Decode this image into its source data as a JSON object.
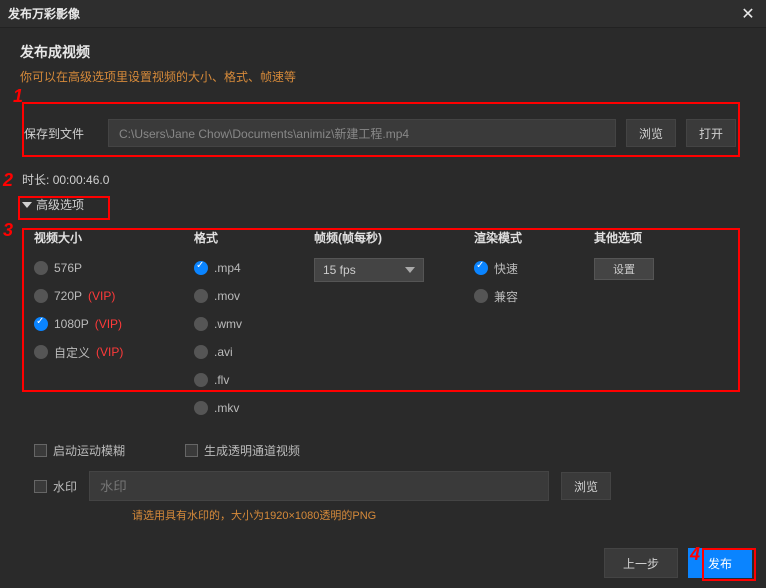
{
  "window": {
    "title": "发布万彩影像"
  },
  "section": {
    "heading": "发布成视频",
    "sub": "你可以在高级选项里设置视频的大小、格式、帧速等"
  },
  "file": {
    "label": "保存到文件",
    "path": "C:\\Users\\Jane Chow\\Documents\\animiz\\新建工程.mp4",
    "browse": "浏览",
    "open": "打开"
  },
  "duration": {
    "label": "时长:",
    "value": "00:00:46.0"
  },
  "advanced": {
    "label": "高级选项"
  },
  "columns": {
    "size": {
      "head": "视频大小",
      "opts": [
        {
          "label": "576P",
          "vip": false,
          "checked": false
        },
        {
          "label": "720P",
          "vip": true,
          "checked": false
        },
        {
          "label": "1080P",
          "vip": true,
          "checked": true
        },
        {
          "label": "自定义",
          "vip": true,
          "checked": false
        }
      ]
    },
    "format": {
      "head": "格式",
      "opts": [
        {
          "label": ".mp4",
          "checked": true
        },
        {
          "label": ".mov",
          "checked": false
        },
        {
          "label": ".wmv",
          "checked": false
        },
        {
          "label": ".avi",
          "checked": false
        },
        {
          "label": ".flv",
          "checked": false
        },
        {
          "label": ".mkv",
          "checked": false
        }
      ]
    },
    "fps": {
      "head": "帧频(帧每秒)",
      "value": "15 fps"
    },
    "render": {
      "head": "渲染模式",
      "opts": [
        {
          "label": "快速",
          "checked": true
        },
        {
          "label": "兼容",
          "checked": false
        }
      ]
    },
    "other": {
      "head": "其他选项",
      "btn": "设置"
    }
  },
  "extras": {
    "motion_blur": "启动运动模糊",
    "alpha_video": "生成透明通道视频",
    "watermark_label": "水印",
    "watermark_placeholder": "水印",
    "watermark_browse": "浏览",
    "watermark_hint": "请选用具有水印的，大小为1920×1080透明的PNG"
  },
  "footer": {
    "prev": "上一步",
    "publish": "发布"
  },
  "vip_tag": "(VIP)",
  "annotations": {
    "a1": "1",
    "a2": "2",
    "a3": "3",
    "a4": "4"
  }
}
